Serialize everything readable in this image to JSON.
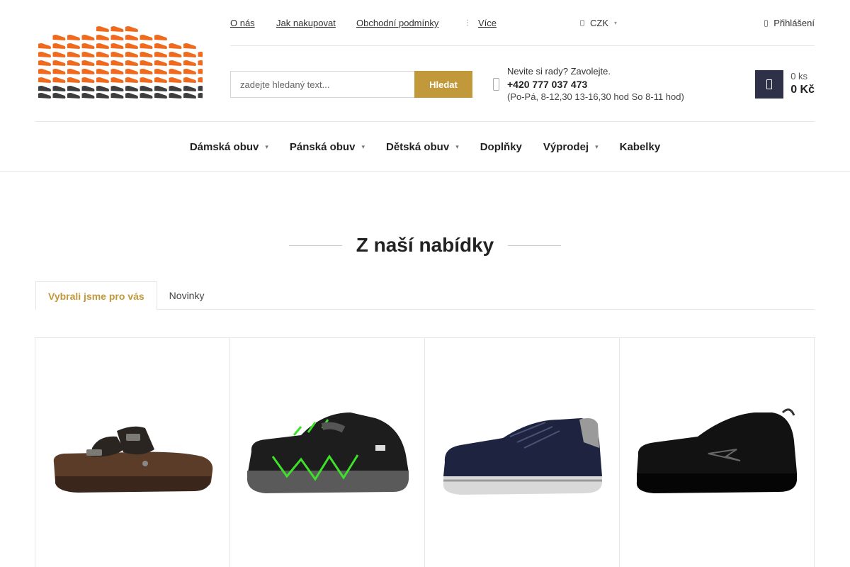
{
  "top_nav": {
    "links": [
      "O nás",
      "Jak nakupovat",
      "Obchodní podmínky"
    ],
    "more_label": "Více",
    "currency": "CZK",
    "login_label": "Přihlášení"
  },
  "search": {
    "placeholder": "zadejte hledaný text...",
    "button_label": "Hledat"
  },
  "contact": {
    "line1": "Nevite si rady? Zavolejte.",
    "phone": "+420 777 037 473",
    "hours": "(Po-Pá, 8-12,30 13-16,30 hod So 8-11 hod)"
  },
  "cart": {
    "count": "0 ks",
    "total": "0 Kč"
  },
  "main_nav": [
    "Dámská obuv",
    "Pánská obuv",
    "Dětská obuv",
    "Doplňky",
    "Výprodej",
    "Kabelky"
  ],
  "section": {
    "title": "Z naší nabídky",
    "tabs": [
      "Vybrali jsme pro vás",
      "Novinky"
    ]
  },
  "colors": {
    "accent": "#c2993a",
    "cart_bg": "#2e3148",
    "logo_orange": "#f06a1e",
    "logo_dark": "#3d3d3d"
  },
  "icons": {
    "more": "dots-icon",
    "currency": "coin-icon",
    "login": "user-icon",
    "phone": "phone-icon",
    "cart": "shopping-bag-icon"
  }
}
